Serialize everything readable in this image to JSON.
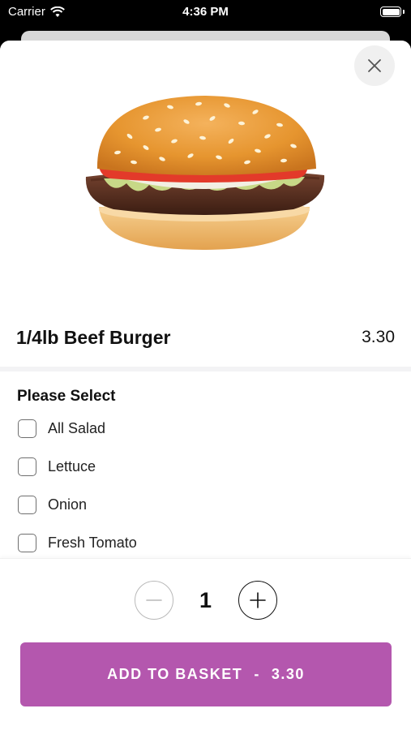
{
  "status_bar": {
    "carrier": "Carrier",
    "time": "4:36 PM"
  },
  "icons": {
    "close": "close-icon",
    "minus": "minus-icon",
    "plus": "plus-icon",
    "wifi": "wifi-icon",
    "battery": "battery-icon",
    "product_image": "burger-image"
  },
  "product": {
    "name": "1/4lb Beef Burger",
    "price": "3.30"
  },
  "options": {
    "heading": "Please Select",
    "items": [
      {
        "label": "All Salad",
        "checked": false
      },
      {
        "label": "Lettuce",
        "checked": false
      },
      {
        "label": "Onion",
        "checked": false
      },
      {
        "label": "Fresh Tomato",
        "checked": false
      }
    ]
  },
  "quantity": {
    "value": "1"
  },
  "add_button": {
    "label": "ADD TO BASKET",
    "separator": "-",
    "total": "3.30"
  },
  "colors": {
    "accent": "#b457ae",
    "status_bar_bg": "#000000",
    "divider": "#f3f3f5"
  }
}
